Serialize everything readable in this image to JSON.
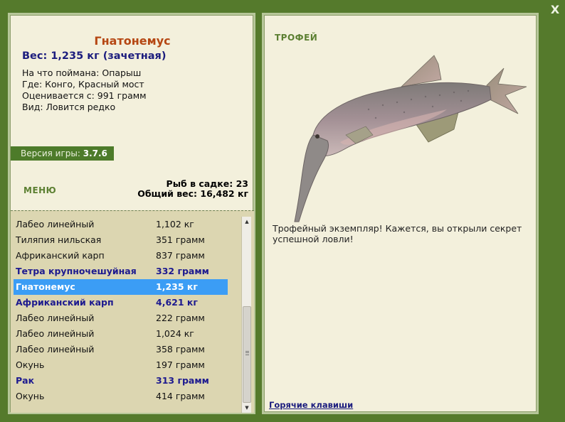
{
  "window": {
    "close_label": "X"
  },
  "catch": {
    "name": "Гнатонемус",
    "weight": "Вес: 1,235 кг (зачетная)",
    "bait": "На что поймана: Опарыш",
    "location": "Где: Конго, Красный мост",
    "valued": "Оценивается с: 991 грамм",
    "rarity": "Вид: Ловится редко"
  },
  "version": {
    "label": "Версия игры:",
    "value": "3.7.6"
  },
  "menu_label": "МЕНЮ",
  "stats": {
    "fish_count": "Рыб в садке: 23",
    "total_weight": "Общий вес: 16,482 кг"
  },
  "list": [
    {
      "name": "Лабео линейный",
      "weight": "1,102 кг",
      "trophy": false,
      "selected": false
    },
    {
      "name": "Тиляпия нильская",
      "weight": "351 грамм",
      "trophy": false,
      "selected": false
    },
    {
      "name": "Африканский карп",
      "weight": "837 грамм",
      "trophy": false,
      "selected": false
    },
    {
      "name": "Тетра крупночешуйная",
      "weight": "332 грамм",
      "trophy": true,
      "selected": false
    },
    {
      "name": "Гнатонемус",
      "weight": "1,235 кг",
      "trophy": true,
      "selected": true
    },
    {
      "name": "Африканский карп",
      "weight": "4,621 кг",
      "trophy": true,
      "selected": false
    },
    {
      "name": "Лабео линейный",
      "weight": "222 грамм",
      "trophy": false,
      "selected": false
    },
    {
      "name": "Лабео линейный",
      "weight": "1,024 кг",
      "trophy": false,
      "selected": false
    },
    {
      "name": "Лабео линейный",
      "weight": "358 грамм",
      "trophy": false,
      "selected": false
    },
    {
      "name": "Окунь",
      "weight": "197 грамм",
      "trophy": false,
      "selected": false
    },
    {
      "name": "Рак",
      "weight": "313 грамм",
      "trophy": true,
      "selected": false
    },
    {
      "name": "Окунь",
      "weight": "414 грамм",
      "trophy": false,
      "selected": false
    }
  ],
  "trophy": {
    "label": "ТРОФЕЙ",
    "text": "Трофейный экземпляр! Кажется, вы открыли секрет успешной ловли!"
  },
  "hotkeys_label": "Горячие клавиши",
  "icons": {
    "close": "close-icon",
    "fish": "gnathonemus-fish-image",
    "scroll_up": "scroll-up-arrow-icon",
    "scroll_down": "scroll-down-arrow-icon"
  }
}
